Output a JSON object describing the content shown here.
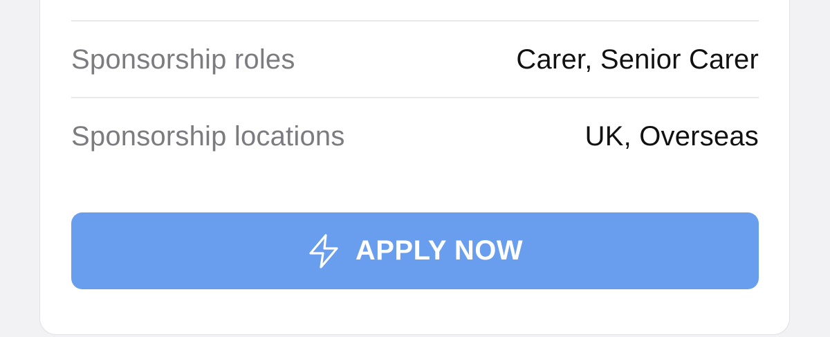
{
  "details": {
    "rows": [
      {
        "label": "Sponsorship roles",
        "value": "Carer, Senior Carer"
      },
      {
        "label": "Sponsorship locations",
        "value": "UK, Overseas"
      }
    ]
  },
  "apply_button": {
    "label": "APPLY NOW",
    "icon": "lightning-bolt-icon"
  },
  "colors": {
    "button_bg": "#699ded",
    "label_text": "#7b7b80",
    "value_text": "#111111",
    "divider": "#e8e8ec",
    "card_bg": "#ffffff"
  }
}
